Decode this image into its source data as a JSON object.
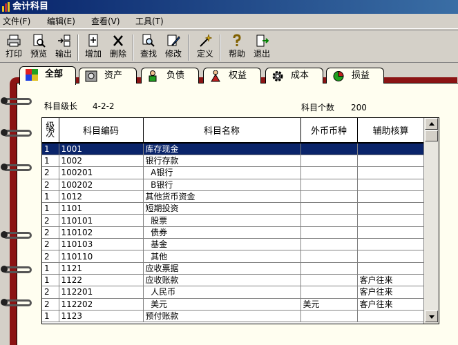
{
  "window": {
    "title": "会计科目"
  },
  "menu": [
    "文件(F)",
    "编辑(E)",
    "查看(V)",
    "工具(T)"
  ],
  "toolbar": {
    "print": "打印",
    "preview": "预览",
    "export": "输出",
    "add": "增加",
    "delete": "删除",
    "find": "查找",
    "edit": "修改",
    "define": "定义",
    "help": "帮助",
    "exit": "退出"
  },
  "tabs": [
    "全部",
    "资产",
    "负债",
    "权益",
    "成本",
    "损益"
  ],
  "info": {
    "level_label": "科目级长",
    "level_value": "4-2-2",
    "count_label": "科目个数",
    "count_value": "200"
  },
  "grid": {
    "headers": {
      "level": "级次",
      "code": "科目编码",
      "name": "科目名称",
      "currency": "外币币种",
      "aux": "辅助核算"
    },
    "rows": [
      {
        "level": "1",
        "code": "1001",
        "name": "库存现金",
        "currency": "",
        "aux": ""
      },
      {
        "level": "1",
        "code": "1002",
        "name": "银行存款",
        "currency": "",
        "aux": ""
      },
      {
        "level": "2",
        "code": "100201",
        "name": "  A银行",
        "currency": "",
        "aux": ""
      },
      {
        "level": "2",
        "code": "100202",
        "name": "  B银行",
        "currency": "",
        "aux": ""
      },
      {
        "level": "1",
        "code": "1012",
        "name": "其他货币资金",
        "currency": "",
        "aux": ""
      },
      {
        "level": "1",
        "code": "1101",
        "name": "短期投资",
        "currency": "",
        "aux": ""
      },
      {
        "level": "2",
        "code": "110101",
        "name": "  股票",
        "currency": "",
        "aux": ""
      },
      {
        "level": "2",
        "code": "110102",
        "name": "  债券",
        "currency": "",
        "aux": ""
      },
      {
        "level": "2",
        "code": "110103",
        "name": "  基金",
        "currency": "",
        "aux": ""
      },
      {
        "level": "2",
        "code": "110110",
        "name": "  其他",
        "currency": "",
        "aux": ""
      },
      {
        "level": "1",
        "code": "1121",
        "name": "应收票据",
        "currency": "",
        "aux": ""
      },
      {
        "level": "1",
        "code": "1122",
        "name": "应收账款",
        "currency": "",
        "aux": "客户往来"
      },
      {
        "level": "2",
        "code": "112201",
        "name": "  人民币",
        "currency": "",
        "aux": "客户往来"
      },
      {
        "level": "2",
        "code": "112202",
        "name": "  美元",
        "currency": "美元",
        "aux": "客户往来"
      },
      {
        "level": "1",
        "code": "1123",
        "name": "预付账款",
        "currency": "",
        "aux": ""
      }
    ]
  },
  "colors": {
    "title_bar": "#08246b",
    "selected_row": "#0a246a",
    "book_cover": "#8b1414",
    "page": "#fffef0"
  }
}
